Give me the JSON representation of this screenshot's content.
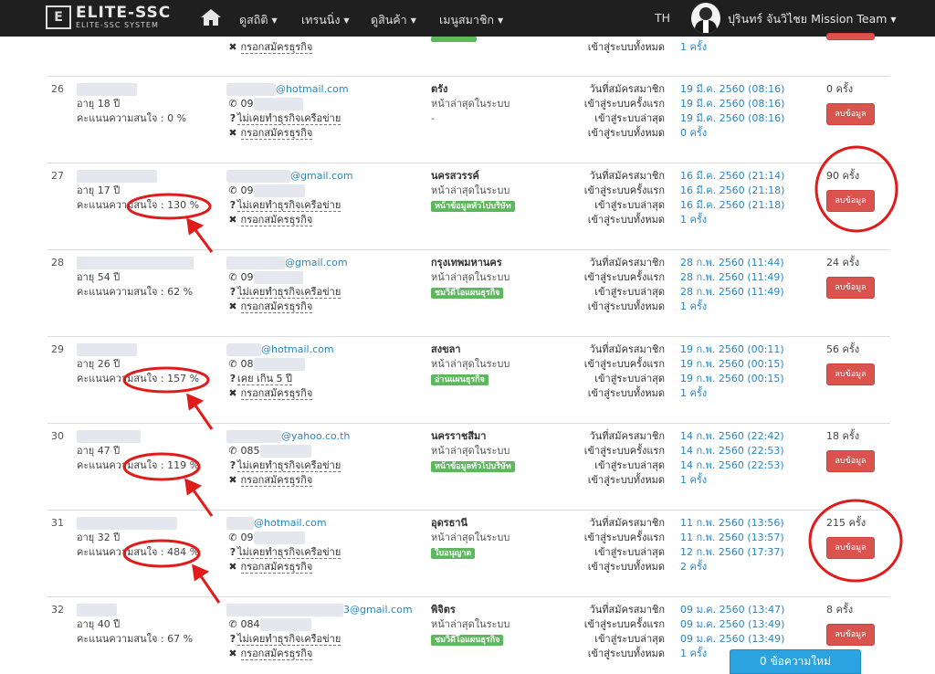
{
  "navbar": {
    "logo_main": "ELITE-SSC",
    "logo_sub": "ELITE-SSC SYSTEM",
    "menu": [
      "ดูสถิติ",
      "เทรนนิ่ง",
      "ดูสินค้า",
      "เมนูสมาชิก"
    ],
    "lang": "TH",
    "user": "ปุรินทร์ จันวิไชย Mission Team"
  },
  "labels": {
    "join": "วันที่สมัครสมาชิก",
    "first": "เข้าสู่ระบบครั้งแรก",
    "last": "เข้าสู่ระบบล่าสุด",
    "total": "เข้าสู่ระบบทั้งหมด",
    "last_online": "หน้าล่าสุดในระบบ",
    "delete": "ลบข้อมูล",
    "fill_business": "กรอกสมัครธุรกิจ",
    "never_network": "ไม่เคยทำธุรกิจเครือข่าย",
    "over5": "เคย เกิน 5 ปี"
  },
  "top_partial": {
    "business": "กรอกสมัครธุรกิจ",
    "total_label": "เข้าสู่ระบบทั้งหมด",
    "total": "1 ครั้ง"
  },
  "rows": [
    {
      "no": "26",
      "age": "อายุ 18 ปี",
      "score": "คะแนนความสนใจ : 0 %",
      "email_domain": "@hotmail.com",
      "phone": "09",
      "experience": "ไม่เคยทำธุรกิจเครือข่าย",
      "business": "กรอกสมัครธุรกิจ",
      "province": "ตรัง",
      "last_page_label": "หน้าล่าสุดในระบบ",
      "last_page": "-",
      "tag": "",
      "join": "19 มี.ค. 2560 (08:16)",
      "first": "19 มี.ค. 2560 (08:16)",
      "last": "19 มี.ค. 2560 (08:16)",
      "total": "0 ครั้ง",
      "visits": "0 ครั้ง",
      "delete": "ลบข้อมูล"
    },
    {
      "no": "27",
      "age": "อายุ 17 ปี",
      "score": "คะแนนความสนใจ : 130 %",
      "email_domain": "@gmail.com",
      "phone": "09",
      "experience": "ไม่เคยทำธุรกิจเครือข่าย",
      "business": "กรอกสมัครธุรกิจ",
      "province": "นครสวรรค์",
      "last_page_label": "หน้าล่าสุดในระบบ",
      "last_page": "",
      "tag": "หน้าข้อมูลทั่วไปบริษัท",
      "join": "16 มี.ค. 2560 (21:14)",
      "first": "16 มี.ค. 2560 (21:18)",
      "last": "16 มี.ค. 2560 (21:18)",
      "total": "1 ครั้ง",
      "visits": "90 ครั้ง",
      "delete": "ลบข้อมูล"
    },
    {
      "no": "28",
      "age": "อายุ 54 ปี",
      "score": "คะแนนความสนใจ : 62 %",
      "email_domain": "@gmail.com",
      "phone": "09",
      "experience": "ไม่เคยทำธุรกิจเครือข่าย",
      "business": "กรอกสมัครธุรกิจ",
      "province": "กรุงเทพมหานคร",
      "last_page_label": "หน้าล่าสุดในระบบ",
      "last_page": "",
      "tag": "ชมวิดีโอแผนธุรกิจ",
      "join": "28 ก.พ. 2560 (11:44)",
      "first": "28 ก.พ. 2560 (11:49)",
      "last": "28 ก.พ. 2560 (11:49)",
      "total": "1 ครั้ง",
      "visits": "24 ครั้ง",
      "delete": "ลบข้อมูล"
    },
    {
      "no": "29",
      "age": "อายุ 26 ปี",
      "score": "คะแนนความสนใจ : 157 %",
      "email_domain": "@hotmail.com",
      "phone": "08",
      "experience": "เคย เกิน 5 ปี",
      "business": "กรอกสมัครธุรกิจ",
      "province": "สงขลา",
      "last_page_label": "หน้าล่าสุดในระบบ",
      "last_page": "",
      "tag": "อ่านแผนธุรกิจ",
      "join": "19 ก.พ. 2560 (00:11)",
      "first": "19 ก.พ. 2560 (00:15)",
      "last": "19 ก.พ. 2560 (00:15)",
      "total": "1 ครั้ง",
      "visits": "56 ครั้ง",
      "delete": "ลบข้อมูล"
    },
    {
      "no": "30",
      "age": "อายุ 47 ปี",
      "score": "คะแนนความสนใจ : 119 %",
      "email_domain": "@yahoo.co.th",
      "phone": "085",
      "experience": "ไม่เคยทำธุรกิจเครือข่าย",
      "business": "กรอกสมัครธุรกิจ",
      "province": "นครราชสีมา",
      "last_page_label": "หน้าล่าสุดในระบบ",
      "last_page": "",
      "tag": "หน้าข้อมูลทั่วไปบริษัท",
      "join": "14 ก.พ. 2560 (22:42)",
      "first": "14 ก.พ. 2560 (22:53)",
      "last": "14 ก.พ. 2560 (22:53)",
      "total": "1 ครั้ง",
      "visits": "18 ครั้ง",
      "delete": "ลบข้อมูล"
    },
    {
      "no": "31",
      "age": "อายุ 32 ปี",
      "score": "คะแนนความสนใจ : 484 %",
      "email_domain": "@hotmail.com",
      "phone": "09",
      "experience": "ไม่เคยทำธุรกิจเครือข่าย",
      "business": "กรอกสมัครธุรกิจ",
      "province": "อุดรธานี",
      "last_page_label": "หน้าล่าสุดในระบบ",
      "last_page": "",
      "tag": "ใบอนุญาต",
      "join": "11 ก.พ. 2560 (13:56)",
      "first": "11 ก.พ. 2560 (13:57)",
      "last": "12 ก.พ. 2560 (17:37)",
      "total": "2 ครั้ง",
      "visits": "215 ครั้ง",
      "delete": "ลบข้อมูล"
    },
    {
      "no": "32",
      "age": "อายุ 40 ปี",
      "score": "คะแนนความสนใจ : 67 %",
      "email_domain": "3@gmail.com",
      "phone": "084",
      "experience": "ไม่เคยทำธุรกิจเครือข่าย",
      "business": "กรอกสมัครธุรกิจ",
      "province": "พิจิตร",
      "last_page_label": "หน้าล่าสุดในระบบ",
      "last_page": "",
      "tag": "ชมวิดีโอแผนธุรกิจ",
      "join": "09 ม.ค. 2560 (13:47)",
      "first": "09 ม.ค. 2560 (13:49)",
      "last": "09 ม.ค. 2560 (13:49)",
      "total": "1 ครั้ง",
      "visits": "8 ครั้ง",
      "delete": "ลบข้อมูล"
    }
  ],
  "new_messages": "0 ข้อความใหม่",
  "colors": {
    "navbar": "#1f1f1f",
    "link": "#2a87c3",
    "tag": "#5cb85c",
    "danger": "#d9534f",
    "annotation": "#e01b1b",
    "message": "#2aa3e0"
  },
  "icons": [
    "home-icon",
    "phone-icon",
    "question-icon",
    "times-icon",
    "caret-down-icon"
  ]
}
